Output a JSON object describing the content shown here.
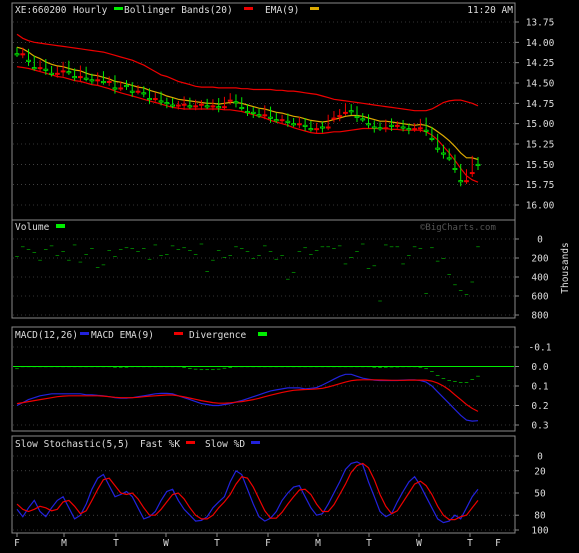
{
  "header": {
    "symbol": "XE:660200",
    "interval": "Hourly",
    "bb_label": "Bollinger Bands(20)",
    "ema_label": "EMA(9)",
    "time": "11:20 AM"
  },
  "watermark": "©BigCharts.com",
  "colors": {
    "up": "#00ee00",
    "down": "#ee0000",
    "bollinger": "#ee0000",
    "ema": "#ddaa00",
    "macd": "#2222dd",
    "macd_ema": "#ee0000",
    "divergence": "#00ee00",
    "fast_k": "#2222dd",
    "slow_d": "#ee0000",
    "text": "#dddddd",
    "grid": "#666666",
    "frame": "#888888"
  },
  "x_ticks": [
    "F",
    "M",
    "T",
    "W",
    "T",
    "F",
    "M",
    "T",
    "W",
    "T",
    "F"
  ],
  "chart_data": [
    {
      "name": "price",
      "type": "candlestick",
      "yticks": [
        "16.00",
        "15.75",
        "15.50",
        "15.25",
        "15.00",
        "14.75",
        "14.50",
        "14.25",
        "14.00",
        "13.75"
      ],
      "ylim": [
        13.7,
        16.05
      ],
      "legend": [
        "Bollinger Bands(20)",
        "EMA(9)"
      ],
      "close": [
        14.14,
        14.12,
        14.22,
        14.31,
        14.26,
        14.33,
        14.38,
        14.35,
        14.28,
        14.36,
        14.42,
        14.34,
        14.44,
        14.46,
        14.41,
        14.48,
        14.46,
        14.56,
        14.52,
        14.53,
        14.6,
        14.58,
        14.62,
        14.69,
        14.66,
        14.72,
        14.74,
        14.77,
        14.76,
        14.72,
        14.78,
        14.76,
        14.75,
        14.78,
        14.74,
        14.79,
        14.71,
        14.68,
        14.73,
        14.8,
        14.85,
        14.86,
        14.89,
        14.83,
        14.92,
        14.95,
        14.93,
        14.97,
        15.0,
        14.97,
        15.02,
        15.06,
        15.03,
        15.04,
        14.93,
        14.9,
        14.86,
        14.8,
        14.84,
        14.91,
        14.94,
        15.0,
        15.04,
        15.05,
        14.99,
        15.02,
        15.01,
        15.04,
        15.06,
        15.05,
        14.98,
        15.08,
        15.18,
        15.3,
        15.36,
        15.42,
        15.55,
        15.7,
        15.6,
        15.45,
        15.5
      ],
      "ema": [
        14.06,
        14.08,
        14.12,
        14.17,
        14.2,
        14.24,
        14.27,
        14.29,
        14.3,
        14.32,
        14.34,
        14.35,
        14.38,
        14.4,
        14.41,
        14.43,
        14.45,
        14.48,
        14.49,
        14.51,
        14.53,
        14.55,
        14.56,
        14.59,
        14.61,
        14.63,
        14.66,
        14.68,
        14.7,
        14.71,
        14.72,
        14.73,
        14.74,
        14.75,
        14.75,
        14.76,
        14.75,
        14.74,
        14.74,
        14.75,
        14.77,
        14.79,
        14.81,
        14.82,
        14.84,
        14.86,
        14.87,
        14.89,
        14.91,
        14.92,
        14.94,
        14.96,
        14.97,
        14.98,
        14.97,
        14.95,
        14.93,
        14.91,
        14.9,
        14.9,
        14.91,
        14.93,
        14.95,
        14.97,
        14.97,
        14.98,
        14.99,
        15.0,
        15.01,
        15.02,
        15.01,
        15.02,
        15.05,
        15.1,
        15.15,
        15.21,
        15.28,
        15.36,
        15.42,
        15.42,
        15.44
      ],
      "bb_upper": [
        14.3,
        14.31,
        14.32,
        14.34,
        14.36,
        14.38,
        14.4,
        14.42,
        14.43,
        14.45,
        14.47,
        14.48,
        14.5,
        14.52,
        14.53,
        14.55,
        14.57,
        14.6,
        14.62,
        14.64,
        14.66,
        14.68,
        14.7,
        14.72,
        14.74,
        14.76,
        14.78,
        14.8,
        14.81,
        14.82,
        14.82,
        14.82,
        14.82,
        14.82,
        14.82,
        14.82,
        14.83,
        14.83,
        14.84,
        14.85,
        14.87,
        14.89,
        14.91,
        14.93,
        14.96,
        14.98,
        15.0,
        15.02,
        15.05,
        15.07,
        15.09,
        15.11,
        15.12,
        15.12,
        15.11,
        15.1,
        15.1,
        15.09,
        15.08,
        15.07,
        15.06,
        15.06,
        15.06,
        15.06,
        15.06,
        15.07,
        15.07,
        15.08,
        15.08,
        15.08,
        15.08,
        15.1,
        15.14,
        15.2,
        15.28,
        15.36,
        15.45,
        15.55,
        15.64,
        15.69,
        15.72
      ],
      "bb_lower": [
        13.9,
        13.95,
        13.98,
        14.0,
        14.01,
        14.02,
        14.03,
        14.04,
        14.05,
        14.06,
        14.07,
        14.08,
        14.09,
        14.1,
        14.11,
        14.12,
        14.14,
        14.16,
        14.18,
        14.2,
        14.22,
        14.25,
        14.28,
        14.32,
        14.36,
        14.4,
        14.42,
        14.45,
        14.48,
        14.5,
        14.52,
        14.54,
        14.55,
        14.55,
        14.55,
        14.56,
        14.56,
        14.56,
        14.56,
        14.57,
        14.57,
        14.58,
        14.58,
        14.58,
        14.58,
        14.59,
        14.59,
        14.6,
        14.6,
        14.61,
        14.62,
        14.63,
        14.64,
        14.66,
        14.68,
        14.7,
        14.71,
        14.72,
        14.73,
        14.74,
        14.75,
        14.76,
        14.77,
        14.78,
        14.79,
        14.8,
        14.81,
        14.82,
        14.83,
        14.84,
        14.84,
        14.84,
        14.82,
        14.78,
        14.74,
        14.72,
        14.71,
        14.71,
        14.73,
        14.75,
        14.78
      ]
    },
    {
      "name": "volume",
      "type": "bar",
      "title": "Volume",
      "ylabel": "Thousands",
      "yticks": [
        "800",
        "600",
        "400",
        "200",
        "0"
      ],
      "ylim": [
        0,
        800
      ],
      "values": [
        180,
        80,
        110,
        140,
        220,
        110,
        70,
        170,
        130,
        220,
        60,
        240,
        160,
        100,
        300,
        270,
        120,
        180,
        110,
        90,
        100,
        130,
        100,
        210,
        60,
        170,
        160,
        70,
        110,
        90,
        120,
        160,
        50,
        340,
        220,
        120,
        190,
        170,
        80,
        100,
        130,
        200,
        170,
        70,
        130,
        210,
        170,
        420,
        350,
        130,
        90,
        160,
        120,
        80,
        80,
        100,
        70,
        260,
        190,
        130,
        50,
        310,
        280,
        650,
        60,
        80,
        80,
        260,
        170,
        80,
        100,
        570,
        90,
        230,
        200,
        370,
        480,
        540,
        580,
        450,
        80
      ]
    },
    {
      "name": "macd",
      "type": "line",
      "legend": [
        "MACD(12,26)",
        "MACD EMA(9)",
        "Divergence"
      ],
      "yticks": [
        "0.3",
        "0.2",
        "0.1",
        "0.0",
        "-0.1"
      ],
      "ylim": [
        -0.12,
        0.31
      ],
      "macd": [
        0.2,
        0.185,
        0.17,
        0.16,
        0.15,
        0.145,
        0.14,
        0.14,
        0.14,
        0.14,
        0.14,
        0.14,
        0.145,
        0.145,
        0.148,
        0.15,
        0.155,
        0.16,
        0.162,
        0.162,
        0.16,
        0.155,
        0.15,
        0.145,
        0.14,
        0.138,
        0.138,
        0.14,
        0.15,
        0.16,
        0.17,
        0.18,
        0.19,
        0.195,
        0.2,
        0.2,
        0.195,
        0.19,
        0.182,
        0.175,
        0.165,
        0.155,
        0.145,
        0.135,
        0.125,
        0.12,
        0.115,
        0.11,
        0.11,
        0.11,
        0.115,
        0.112,
        0.108,
        0.095,
        0.08,
        0.065,
        0.05,
        0.04,
        0.04,
        0.05,
        0.06,
        0.065,
        0.07,
        0.072,
        0.072,
        0.072,
        0.072,
        0.07,
        0.068,
        0.068,
        0.072,
        0.08,
        0.1,
        0.13,
        0.16,
        0.19,
        0.22,
        0.25,
        0.275,
        0.28,
        0.278
      ],
      "macd_ema": [
        0.19,
        0.185,
        0.18,
        0.175,
        0.17,
        0.165,
        0.16,
        0.155,
        0.152,
        0.15,
        0.15,
        0.15,
        0.15,
        0.15,
        0.15,
        0.152,
        0.155,
        0.158,
        0.16,
        0.16,
        0.16,
        0.158,
        0.155,
        0.152,
        0.15,
        0.148,
        0.146,
        0.146,
        0.15,
        0.156,
        0.162,
        0.168,
        0.175,
        0.18,
        0.185,
        0.188,
        0.188,
        0.186,
        0.183,
        0.18,
        0.175,
        0.17,
        0.163,
        0.155,
        0.147,
        0.14,
        0.133,
        0.127,
        0.122,
        0.12,
        0.118,
        0.117,
        0.115,
        0.112,
        0.105,
        0.097,
        0.088,
        0.08,
        0.073,
        0.069,
        0.068,
        0.068,
        0.068,
        0.069,
        0.07,
        0.071,
        0.071,
        0.071,
        0.07,
        0.07,
        0.07,
        0.07,
        0.075,
        0.085,
        0.1,
        0.12,
        0.145,
        0.17,
        0.195,
        0.215,
        0.23
      ],
      "divergence": [
        0.01,
        0.0,
        -0.01,
        -0.015,
        -0.02,
        -0.02,
        -0.02,
        -0.015,
        -0.012,
        -0.01,
        -0.01,
        -0.01,
        -0.005,
        -0.005,
        -0.002,
        -0.002,
        0.0,
        0.002,
        0.002,
        0.002,
        0.0,
        -0.003,
        -0.005,
        -0.007,
        -0.01,
        -0.01,
        -0.008,
        -0.006,
        0.0,
        0.004,
        0.008,
        0.012,
        0.015,
        0.015,
        0.015,
        0.012,
        0.007,
        0.004,
        -0.001,
        -0.005,
        -0.01,
        -0.015,
        -0.018,
        -0.02,
        -0.022,
        -0.02,
        -0.018,
        -0.017,
        -0.012,
        -0.01,
        -0.003,
        -0.005,
        -0.007,
        -0.017,
        -0.025,
        -0.032,
        -0.038,
        -0.04,
        -0.033,
        -0.019,
        -0.008,
        -0.003,
        0.002,
        0.003,
        0.002,
        0.001,
        0.001,
        -0.001,
        -0.002,
        -0.002,
        0.002,
        0.01,
        0.025,
        0.045,
        0.06,
        0.07,
        0.075,
        0.08,
        0.08,
        0.065,
        0.048
      ]
    },
    {
      "name": "stochastic",
      "type": "line",
      "legend": [
        "Slow Stochastic(5,5)",
        "Fast %K",
        "Slow %D"
      ],
      "yticks": [
        "100",
        "80",
        "50",
        "20",
        "0"
      ],
      "ylim": [
        0,
        100
      ],
      "fast_k": [
        72,
        82,
        70,
        60,
        75,
        82,
        70,
        60,
        55,
        70,
        85,
        80,
        65,
        45,
        30,
        25,
        40,
        55,
        52,
        48,
        55,
        70,
        85,
        82,
        75,
        60,
        48,
        45,
        60,
        72,
        80,
        88,
        87,
        82,
        70,
        62,
        55,
        35,
        20,
        25,
        45,
        65,
        82,
        88,
        84,
        75,
        60,
        50,
        42,
        40,
        55,
        70,
        80,
        78,
        65,
        50,
        35,
        18,
        10,
        8,
        12,
        35,
        55,
        75,
        82,
        78,
        62,
        48,
        35,
        28,
        40,
        55,
        70,
        85,
        90,
        88,
        80,
        85,
        70,
        55,
        45
      ],
      "slow_d": [
        65,
        72,
        75,
        72,
        68,
        70,
        74,
        72,
        62,
        60,
        68,
        78,
        74,
        60,
        45,
        32,
        30,
        40,
        50,
        52,
        50,
        58,
        70,
        80,
        80,
        72,
        62,
        52,
        50,
        58,
        70,
        80,
        85,
        85,
        80,
        70,
        62,
        52,
        38,
        28,
        30,
        42,
        58,
        74,
        84,
        84,
        76,
        65,
        55,
        46,
        45,
        52,
        65,
        75,
        75,
        66,
        52,
        38,
        22,
        13,
        10,
        16,
        32,
        52,
        68,
        78,
        74,
        62,
        50,
        38,
        34,
        40,
        52,
        68,
        80,
        86,
        86,
        82,
        80,
        70,
        60
      ]
    }
  ]
}
